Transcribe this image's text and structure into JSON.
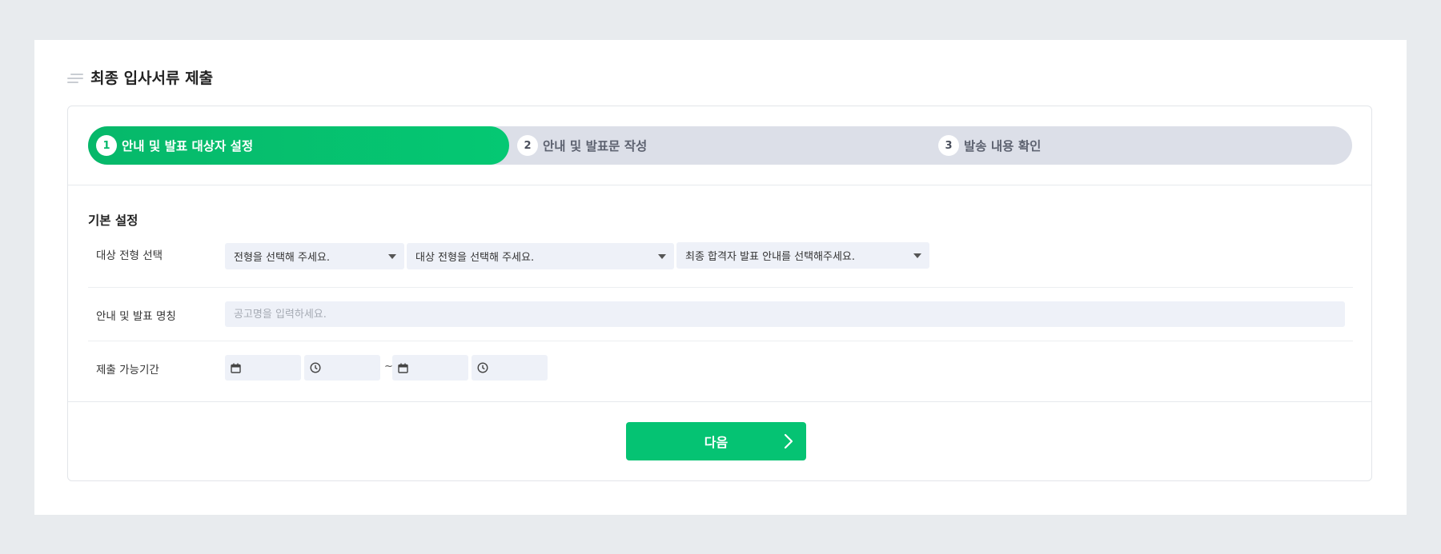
{
  "page": {
    "title": "최종 입사서류 제출"
  },
  "stepper": {
    "steps": [
      {
        "number": "1",
        "label": "안내 및 발표 대상자 설정",
        "active": true
      },
      {
        "number": "2",
        "label": "안내 및 발표문 작성",
        "active": false
      },
      {
        "number": "3",
        "label": "발송 내용 확인",
        "active": false
      }
    ]
  },
  "form": {
    "section_title": "기본 설정",
    "target_row": {
      "label": "대상 전형 선택",
      "select1": "전형을 선택해 주세요.",
      "select2": "대상 전형을 선택해 주세요.",
      "select3": "최종 합격자 발표 안내를 선택해주세요."
    },
    "name_row": {
      "label": "안내 및 발표 명칭",
      "placeholder": "공고명을 입력하세요."
    },
    "period_row": {
      "label": "제출 가능기간",
      "separator": "~"
    }
  },
  "actions": {
    "next_label": "다음"
  },
  "colors": {
    "accent": "#05c373",
    "stepper_bg": "#dcdfe8",
    "input_bg": "#eef1f8",
    "page_bg": "#e8ebee"
  }
}
